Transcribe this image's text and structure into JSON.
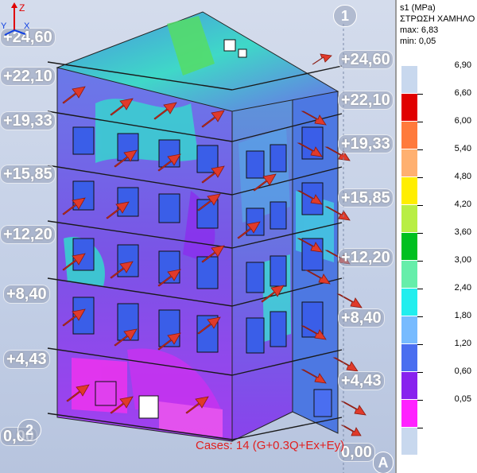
{
  "viewport": {
    "level_labels": [
      "+24,60",
      "+22,10",
      "+19,33",
      "+15,85",
      "+12,20",
      "+8,40",
      "+4,43",
      "0,00"
    ],
    "right_level_labels": [
      "+24,60",
      "+22,10",
      "+19,33",
      "+15,85",
      "+12,20",
      "+8,40",
      "+4,43",
      "0,00"
    ],
    "grid_axis_top": "1",
    "grid_axis_bottom_left": "2",
    "grid_axis_bottom_right": "A",
    "case_label": "Cases: 14 (G+0.3Q+Ex+Ey)",
    "triad": {
      "x": "X",
      "y": "Y",
      "z": "Z"
    }
  },
  "legend": {
    "quantity": "s1 (MPa)",
    "layer": "ΣΤΡΩΣΗ ΧΑΜΗΛΟ",
    "max_label": "max: 6,83",
    "min_label": "min: 0,05",
    "ticks": [
      "6,90",
      "6,60",
      "6,00",
      "5,40",
      "4,80",
      "4,20",
      "3,60",
      "3,00",
      "2,40",
      "1,80",
      "1,20",
      "0,60",
      "0,05"
    ],
    "colors": [
      "#c8d8ee",
      "#e00000",
      "#ff7a3c",
      "#ffb070",
      "#ffee00",
      "#b8ee44",
      "#00c020",
      "#66eeaa",
      "#22eeee",
      "#77bbff",
      "#4a6ef0",
      "#8822ee",
      "#ff22ff",
      "#c8d8ee"
    ]
  }
}
